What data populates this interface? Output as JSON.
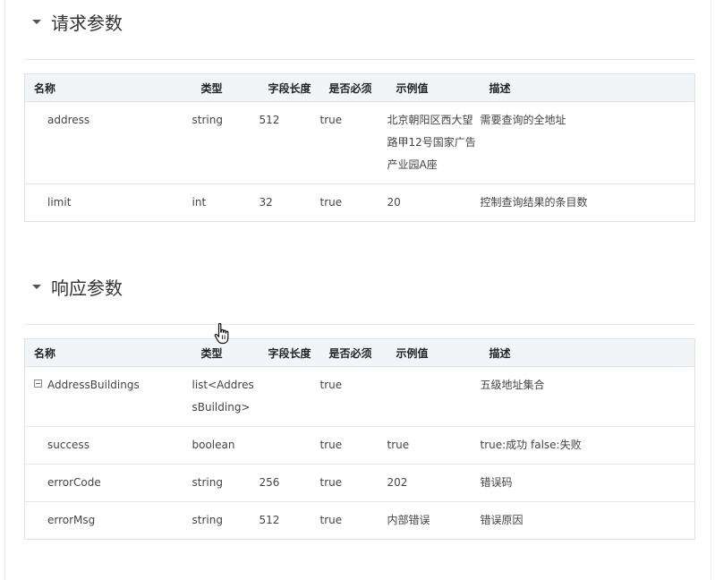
{
  "request_section": {
    "title": "请求参数",
    "columns": [
      "名称",
      "类型",
      "字段长度",
      "是否必须",
      "示例值",
      "描述"
    ],
    "rows": [
      {
        "name": "address",
        "type": "string",
        "length": "512",
        "required": "true",
        "example": "北京朝阳区西大望路甲12号国家广告产业园A座",
        "desc": "需要查询的全地址"
      },
      {
        "name": "limit",
        "type": "int",
        "length": "32",
        "required": "true",
        "example": "20",
        "desc": "控制查询结果的条目数"
      }
    ]
  },
  "response_section": {
    "title": "响应参数",
    "columns": [
      "名称",
      "类型",
      "字段长度",
      "是否必须",
      "示例值",
      "描述"
    ],
    "rows": [
      {
        "name": "AddressBuildings",
        "type": "list<AddressBuilding>",
        "length": "",
        "required": "true",
        "example": "",
        "desc": "五级地址集合"
      },
      {
        "name": "success",
        "type": "boolean",
        "length": "",
        "required": "true",
        "example": "true",
        "desc": "true:成功 false:失败"
      },
      {
        "name": "errorCode",
        "type": "string",
        "length": "256",
        "required": "true",
        "example": "202",
        "desc": "错误码"
      },
      {
        "name": "errorMsg",
        "type": "string",
        "length": "512",
        "required": "true",
        "example": "内部错误",
        "desc": "错误原因"
      }
    ]
  },
  "icons": {
    "caret": "caret-down-icon",
    "expand": "minus-square-icon",
    "cursor": "hand-pointer-icon"
  }
}
